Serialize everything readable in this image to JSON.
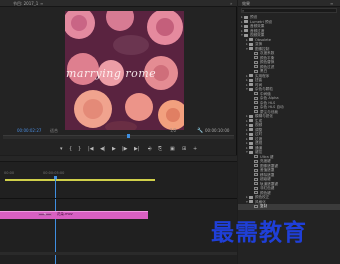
{
  "monitor": {
    "title": "节目: 2017_1",
    "menu_icon": "≡",
    "chevron_icon": "»",
    "video_overlay_text": "marrying rome",
    "timecode_current": "00:00:02:27",
    "fit": "适合",
    "resolution": "1/2",
    "timecode_total": "00:00:10:00",
    "transport": [
      "▾",
      "{",
      "}",
      "|◀",
      "◀|",
      "▶",
      "|▶",
      "▶|",
      "⎆",
      "⎘",
      "▣",
      "⊞",
      "+"
    ]
  },
  "timeline": {
    "time_left": "00:00",
    "time_mid": "00:00:05:00",
    "clip_fx": "fx",
    "clip_name": "花朵.mov"
  },
  "effects": {
    "title": "效果",
    "menu_icon": "≡",
    "search_icon": "⌕",
    "rows": [
      {
        "label": "预设",
        "type": "folder",
        "twisty": "▸",
        "indent": 0
      },
      {
        "label": "Lumetri 预设",
        "type": "folder",
        "twisty": "▸",
        "indent": 0
      },
      {
        "label": "音频效果",
        "type": "folder",
        "twisty": "▸",
        "indent": 0
      },
      {
        "label": "音频过渡",
        "type": "folder",
        "twisty": "▸",
        "indent": 0
      },
      {
        "label": "视频效果",
        "type": "folder",
        "twisty": "▾",
        "indent": 0
      },
      {
        "label": "Obsolete",
        "type": "folder",
        "twisty": "▸",
        "indent": 1
      },
      {
        "label": "变换",
        "type": "folder",
        "twisty": "▸",
        "indent": 1
      },
      {
        "label": "图像控制",
        "type": "folder",
        "twisty": "▾",
        "indent": 1
      },
      {
        "label": "灰度系数",
        "type": "item",
        "twisty": "",
        "indent": 2
      },
      {
        "label": "颜色平衡",
        "type": "item",
        "twisty": "",
        "indent": 2
      },
      {
        "label": "颜色替换",
        "type": "item",
        "twisty": "",
        "indent": 2
      },
      {
        "label": "颜色过滤",
        "type": "item",
        "twisty": "",
        "indent": 2
      },
      {
        "label": "黑白",
        "type": "item",
        "twisty": "",
        "indent": 2
      },
      {
        "label": "实用程序",
        "type": "folder",
        "twisty": "▸",
        "indent": 1
      },
      {
        "label": "扭曲",
        "type": "folder",
        "twisty": "▸",
        "indent": 1
      },
      {
        "label": "时间",
        "type": "folder",
        "twisty": "▸",
        "indent": 1
      },
      {
        "label": "杂色与颗粒",
        "type": "folder",
        "twisty": "▾",
        "indent": 1
      },
      {
        "label": "中间值",
        "type": "item",
        "twisty": "",
        "indent": 2
      },
      {
        "label": "杂色 Alpha",
        "type": "item",
        "twisty": "",
        "indent": 2
      },
      {
        "label": "杂色 HLS",
        "type": "item",
        "twisty": "",
        "indent": 2
      },
      {
        "label": "杂色 HLS 自动",
        "type": "item",
        "twisty": "",
        "indent": 2
      },
      {
        "label": "蒙尘与划痕",
        "type": "item",
        "twisty": "",
        "indent": 2
      },
      {
        "label": "模糊与锐化",
        "type": "folder",
        "twisty": "▸",
        "indent": 1
      },
      {
        "label": "生成",
        "type": "folder",
        "twisty": "▸",
        "indent": 1
      },
      {
        "label": "视频",
        "type": "folder",
        "twisty": "▸",
        "indent": 1
      },
      {
        "label": "调整",
        "type": "folder",
        "twisty": "▸",
        "indent": 1
      },
      {
        "label": "过时",
        "type": "folder",
        "twisty": "▸",
        "indent": 1
      },
      {
        "label": "过渡",
        "type": "folder",
        "twisty": "▸",
        "indent": 1
      },
      {
        "label": "透视",
        "type": "folder",
        "twisty": "▸",
        "indent": 1
      },
      {
        "label": "通道",
        "type": "folder",
        "twisty": "▸",
        "indent": 1
      },
      {
        "label": "键控",
        "type": "folder",
        "twisty": "▾",
        "indent": 1
      },
      {
        "label": "Ultra 键",
        "type": "item",
        "twisty": "",
        "indent": 2
      },
      {
        "label": "亮度键",
        "type": "item",
        "twisty": "",
        "indent": 2
      },
      {
        "label": "图像遮罩键",
        "type": "item",
        "twisty": "",
        "indent": 2
      },
      {
        "label": "差值遮罩",
        "type": "item",
        "twisty": "",
        "indent": 2
      },
      {
        "label": "移除遮罩",
        "type": "item",
        "twisty": "",
        "indent": 2
      },
      {
        "label": "超级键",
        "type": "item",
        "twisty": "",
        "indent": 2
      },
      {
        "label": "轨道遮罩键",
        "type": "item",
        "twisty": "",
        "indent": 2
      },
      {
        "label": "非红色键",
        "type": "item",
        "twisty": "",
        "indent": 2
      },
      {
        "label": "颜色键",
        "type": "item",
        "twisty": "",
        "indent": 2
      },
      {
        "label": "颜色校正",
        "type": "folder",
        "twisty": "▸",
        "indent": 1
      },
      {
        "label": "风格化",
        "type": "folder",
        "twisty": "▾",
        "indent": 1
      },
      {
        "label": "复制",
        "type": "item",
        "twisty": "",
        "indent": 2,
        "selected": true
      }
    ]
  },
  "watermark": "最需教育"
}
